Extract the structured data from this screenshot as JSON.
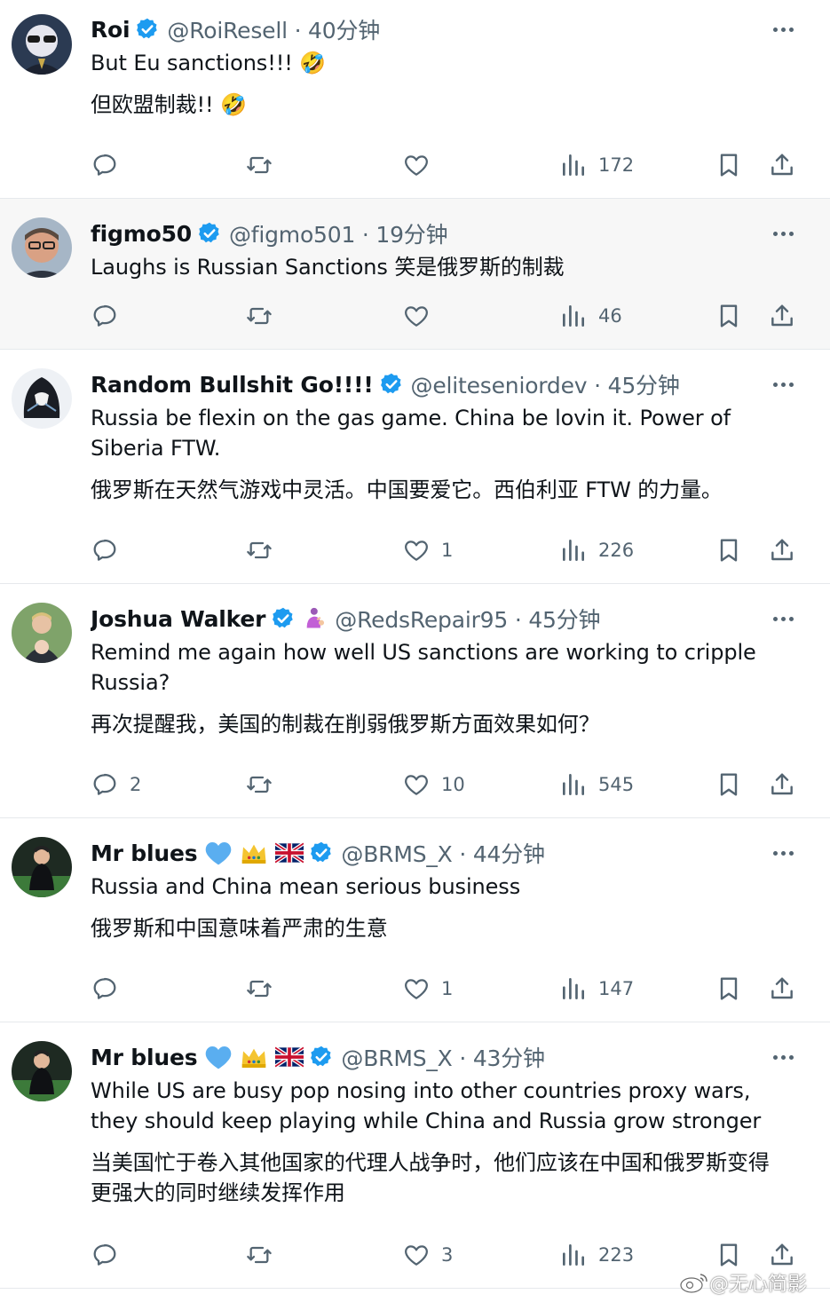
{
  "tweets": [
    {
      "name": "Roi",
      "handle": "@RoiResell · 40分钟",
      "lines": [
        "But Eu sanctions!!! 🤣",
        "但欧盟制裁!! 🤣"
      ],
      "replies": "",
      "likes": "",
      "views": "172"
    },
    {
      "name": "figmo50",
      "handle": "@figmo501 · 19分钟",
      "lines": [
        "Laughs is Russian Sanctions 笑是俄罗斯的制裁"
      ],
      "replies": "",
      "likes": "",
      "views": "46"
    },
    {
      "name": "Random Bullshit Go!!!!",
      "handle": "@eliteseniordev · 45分钟",
      "lines": [
        "Russia be flexin on the gas game. China be lovin it. Power of Siberia FTW.",
        "俄罗斯在天然气游戏中灵活。中国要爱它。西伯利亚 FTW 的力量。"
      ],
      "replies": "",
      "likes": "1",
      "views": "226"
    },
    {
      "name": "Joshua Walker",
      "handle": "@RedsRepair95 · 45分钟",
      "lines": [
        "Remind me again how well US sanctions are working to cripple Russia?",
        "再次提醒我，美国的制裁在削弱俄罗斯方面效果如何？"
      ],
      "replies": "2",
      "likes": "10",
      "views": "545"
    },
    {
      "name": "Mr blues",
      "handle": "@BRMS_X · 44分钟",
      "lines": [
        "Russia and China mean serious business",
        "俄罗斯和中国意味着严肃的生意"
      ],
      "replies": "",
      "likes": "1",
      "views": "147"
    },
    {
      "name": "Mr blues",
      "handle": "@BRMS_X · 43分钟",
      "lines": [
        "While US are busy pop nosing into other countries proxy wars, they should keep playing while China and Russia grow stronger",
        "当美国忙于卷入其他国家的代理人战争时，他们应该在中国和俄罗斯变得更强大的同时继续发挥作用"
      ],
      "replies": "",
      "likes": "3",
      "views": "223"
    }
  ],
  "watermark": "@无心简影",
  "colors": {
    "verified": "#1d9bf0",
    "text": "#0f1419",
    "secondary": "#536471",
    "divider": "#e6e9ec",
    "highlight": "#f7f7f7"
  },
  "icons": [
    "reply-icon",
    "retweet-icon",
    "like-icon",
    "views-icon",
    "bookmark-icon",
    "share-icon",
    "more-icon",
    "verified-badge-icon"
  ]
}
